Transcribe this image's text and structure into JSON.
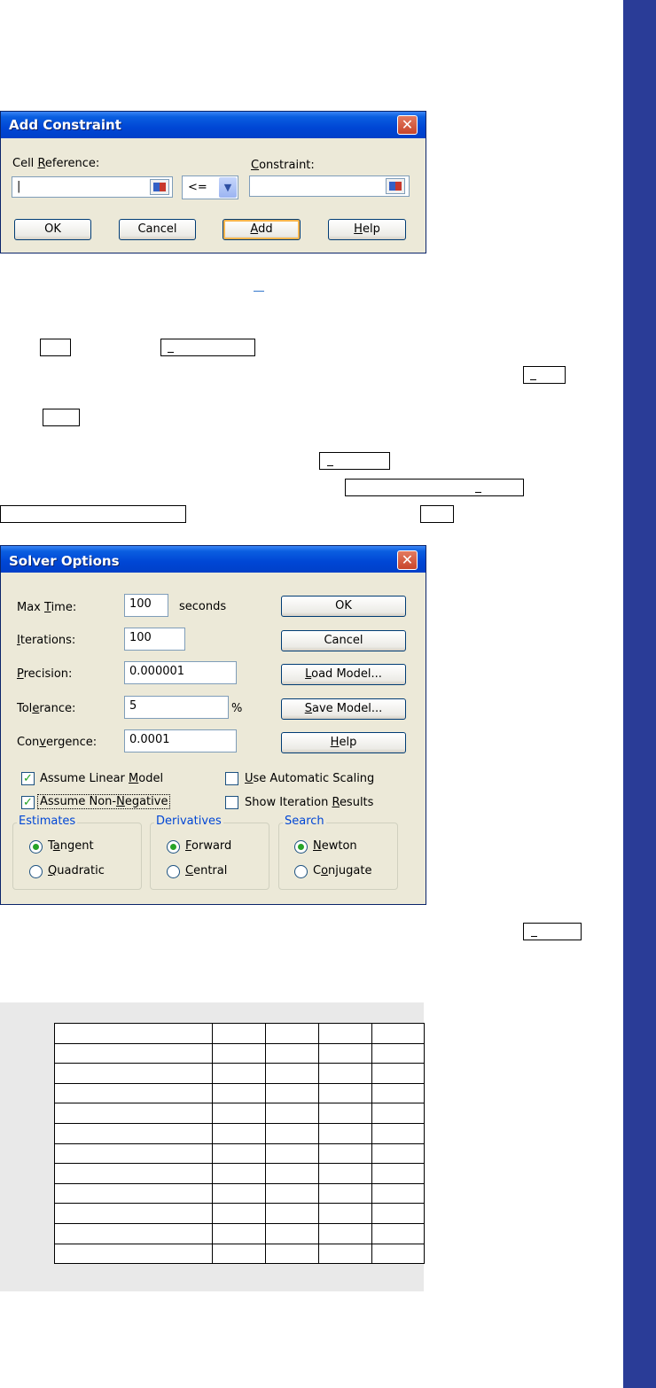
{
  "add_constraint": {
    "title": "Add Constraint",
    "cell_reference_label": "Cell Reference:",
    "constraint_label": "Constraint:",
    "cell_reference_value": "|",
    "operator": "<=",
    "constraint_value": "",
    "buttons": {
      "ok": "OK",
      "cancel": "Cancel",
      "add": "Add",
      "help": "Help"
    }
  },
  "solver_options": {
    "title": "Solver Options",
    "max_time_label": "Max Time:",
    "max_time_value": "100",
    "seconds_label": "seconds",
    "iterations_label": "Iterations:",
    "iterations_value": "100",
    "precision_label": "Precision:",
    "precision_value": "0.000001",
    "tolerance_label": "Tolerance:",
    "tolerance_value": "5",
    "percent_label": "%",
    "convergence_label": "Convergence:",
    "convergence_value": "0.0001",
    "buttons": {
      "ok": "OK",
      "cancel": "Cancel",
      "load_model": "Load Model...",
      "save_model": "Save Model...",
      "help": "Help"
    },
    "checkboxes": {
      "assume_linear": {
        "label": "Assume Linear Model",
        "checked": true
      },
      "assume_non_negative": {
        "label": "Assume Non-Negative",
        "checked": true
      },
      "automatic_scaling": {
        "label": "Use Automatic Scaling",
        "checked": false
      },
      "show_iteration": {
        "label": "Show Iteration Results",
        "checked": false
      }
    },
    "estimates": {
      "title": "Estimates",
      "tangent": "Tangent",
      "quadratic": "Quadratic",
      "selected": "Tangent"
    },
    "derivatives": {
      "title": "Derivatives",
      "forward": "Forward",
      "central": "Central",
      "selected": "Forward"
    },
    "search": {
      "title": "Search",
      "newton": "Newton",
      "conjugate": "Conjugate",
      "selected": "Newton"
    }
  },
  "colors": {
    "sidebar": "#2a3c97",
    "titlebar": "#0046d5",
    "dialog_bg": "#ece9d8",
    "check": "#21a121"
  }
}
